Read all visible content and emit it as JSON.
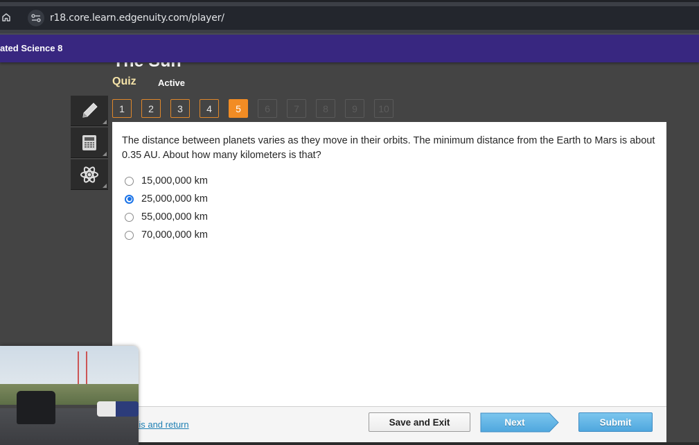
{
  "browser": {
    "url": "r18.core.learn.edgenuity.com/player/"
  },
  "course": {
    "title": "ated Science 8"
  },
  "lesson": {
    "title": "The Sun",
    "activity_type": "Quiz",
    "status": "Active"
  },
  "tools": [
    {
      "name": "pencil-icon",
      "label": "Annotate"
    },
    {
      "name": "calculator-icon",
      "label": "Calculator"
    },
    {
      "name": "atom-icon",
      "label": "Reference"
    }
  ],
  "question_nav": {
    "current": 5,
    "items": [
      {
        "label": "1",
        "state": "answered"
      },
      {
        "label": "2",
        "state": "answered"
      },
      {
        "label": "3",
        "state": "answered"
      },
      {
        "label": "4",
        "state": "answered"
      },
      {
        "label": "5",
        "state": "current"
      },
      {
        "label": "6",
        "state": "disabled"
      },
      {
        "label": "7",
        "state": "disabled"
      },
      {
        "label": "8",
        "state": "disabled"
      },
      {
        "label": "9",
        "state": "disabled"
      },
      {
        "label": "10",
        "state": "disabled"
      }
    ]
  },
  "question": {
    "text": "The distance between planets varies as they move in their orbits. The minimum distance from the Earth to Mars is about 0.35 AU. About how many kilometers is that?",
    "answers": [
      {
        "label": "15,000,000 km",
        "selected": false
      },
      {
        "label": "25,000,000 km",
        "selected": true
      },
      {
        "label": "55,000,000 km",
        "selected": false
      },
      {
        "label": "70,000,000 km",
        "selected": false
      }
    ]
  },
  "footer": {
    "mark_link": "Mark this and return",
    "save_exit": "Save and Exit",
    "next": "Next",
    "submit": "Submit"
  },
  "colors": {
    "header_purple": "#382780",
    "accent_orange": "#f28c24",
    "button_blue": "#4fa7de",
    "radio_blue": "#1a73e8"
  }
}
